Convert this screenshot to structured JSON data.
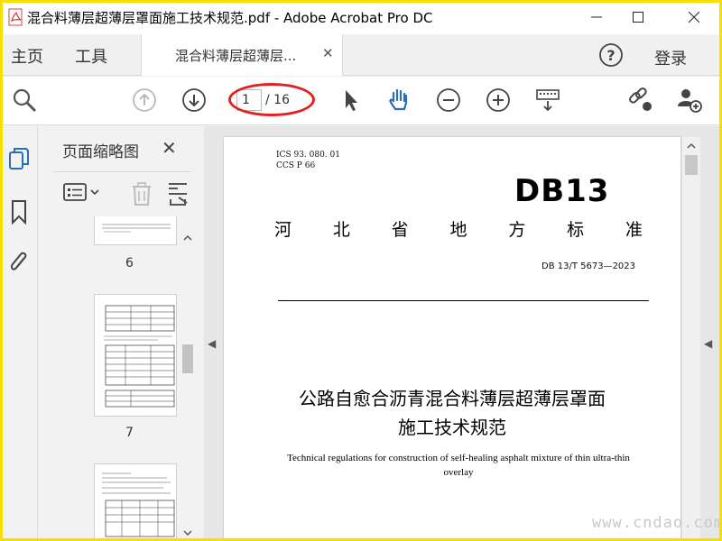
{
  "window": {
    "title": "混合料薄层超薄层罩面施工技术规范.pdf - Adobe Acrobat Pro DC",
    "icon": "acrobat-pdf-icon"
  },
  "tabs": {
    "home": "主页",
    "tools": "工具",
    "document": "混合料薄层超薄层...",
    "login": "登录"
  },
  "toolbar": {
    "current_page": "1",
    "total_pages": "/ 16",
    "icons": [
      "zoom-search-icon",
      "page-up-icon",
      "page-down-icon",
      "select-arrow-icon",
      "hand-tool-icon",
      "zoom-out-icon",
      "zoom-in-icon",
      "keyboard-icon",
      "share-link-icon",
      "add-user-icon"
    ],
    "accent": "#2a6fb5",
    "highlight": "#e22020"
  },
  "sidebar": {
    "panel_title": "页面缩略图",
    "thumbnails": [
      {
        "label": "6"
      },
      {
        "label": "7"
      },
      {
        "label": ""
      }
    ]
  },
  "document": {
    "ics": "ICS  93. 080. 01",
    "ccs": "CCS  P 66",
    "db": "DB13",
    "province": [
      "河",
      "北",
      "省",
      "地",
      "方",
      "标",
      "准"
    ],
    "code": "DB 13/T 5673—2023",
    "title_line1": "公路自愈合沥青混合料薄层超薄层罩面",
    "title_line2": "施工技术规范",
    "title_en": "Technical regulations for construction of self-healing asphalt mixture of thin ultra-thin overlay"
  },
  "watermark": "www.cndao.com"
}
